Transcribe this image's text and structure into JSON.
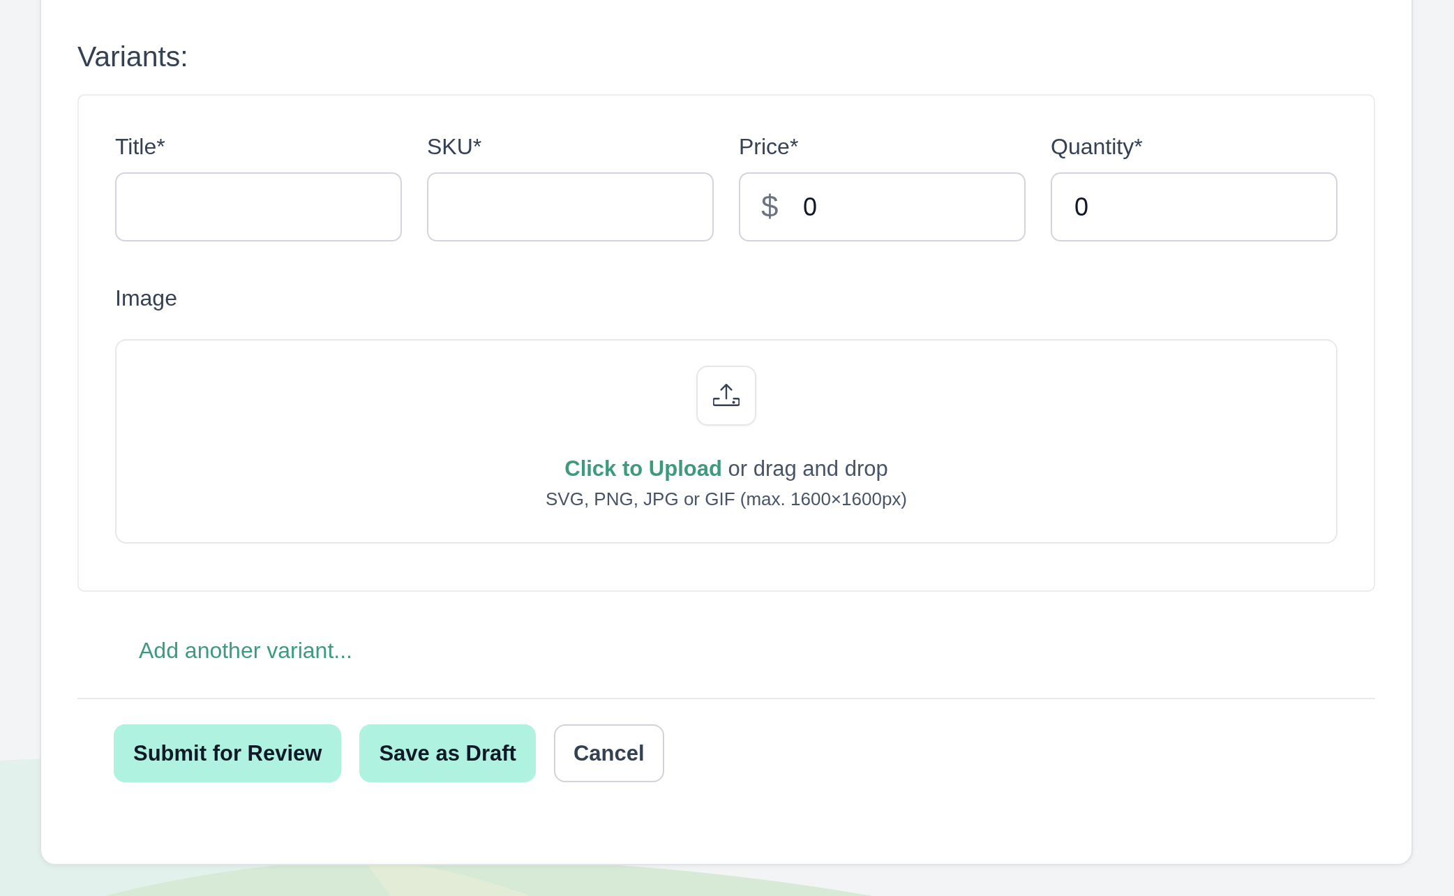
{
  "heading": "Variants:",
  "fields": [
    {
      "label": "Title*",
      "kind": "text"
    },
    {
      "label": "SKU*",
      "kind": "text"
    },
    {
      "label": "Price*",
      "kind": "currency",
      "prefix": "$",
      "value": "0"
    },
    {
      "label": "Quantity*",
      "kind": "number",
      "value": "0"
    }
  ],
  "image": {
    "label": "Image",
    "link": "Click to Upload",
    "text": "or drag and drop",
    "hint": "SVG, PNG, JPG or GIF (max. 1600×1600px)"
  },
  "add_variant": "Add another variant...",
  "buttons": [
    {
      "label": "Submit for Review",
      "kind": "primary"
    },
    {
      "label": "Save as Draft",
      "kind": "primary"
    },
    {
      "label": "Cancel",
      "kind": "secondary"
    }
  ]
}
